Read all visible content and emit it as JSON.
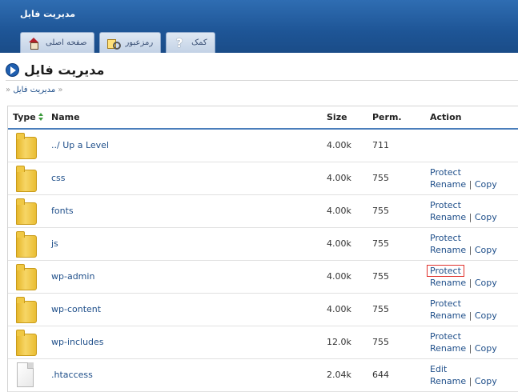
{
  "header": {
    "app_title": "مدیریت فایل"
  },
  "tabs": [
    {
      "label": "صفحه اصلی",
      "icon": "home-icon"
    },
    {
      "label": "رمزعبور",
      "icon": "key-icon"
    },
    {
      "label": "کمک",
      "icon": "help-icon",
      "glyph": "?"
    }
  ],
  "page": {
    "title": "مدیریت فایل",
    "breadcrumb_sep": "«",
    "breadcrumb_item": "مدیریت فایل",
    "breadcrumb_trail": "«"
  },
  "table": {
    "columns": {
      "type": "Type",
      "name": "Name",
      "size": "Size",
      "perm": "Perm.",
      "action": "Action"
    },
    "rows": [
      {
        "kind": "folder",
        "name": "../ Up a Level",
        "size": "4.00k",
        "perm": "711",
        "actions": []
      },
      {
        "kind": "folder",
        "name": "css",
        "size": "4.00k",
        "perm": "755",
        "actions": [
          "Protect",
          "Rename",
          "Copy"
        ]
      },
      {
        "kind": "folder",
        "name": "fonts",
        "size": "4.00k",
        "perm": "755",
        "actions": [
          "Protect",
          "Rename",
          "Copy"
        ]
      },
      {
        "kind": "folder",
        "name": "js",
        "size": "4.00k",
        "perm": "755",
        "actions": [
          "Protect",
          "Rename",
          "Copy"
        ]
      },
      {
        "kind": "folder",
        "name": "wp-admin",
        "size": "4.00k",
        "perm": "755",
        "actions": [
          "Protect",
          "Rename",
          "Copy"
        ],
        "highlight_first_action": true
      },
      {
        "kind": "folder",
        "name": "wp-content",
        "size": "4.00k",
        "perm": "755",
        "actions": [
          "Protect",
          "Rename",
          "Copy"
        ]
      },
      {
        "kind": "folder",
        "name": "wp-includes",
        "size": "12.0k",
        "perm": "755",
        "actions": [
          "Protect",
          "Rename",
          "Copy"
        ]
      },
      {
        "kind": "file",
        "name": ".htaccess",
        "size": "2.04k",
        "perm": "644",
        "actions": [
          "Edit",
          "Rename",
          "Copy"
        ]
      }
    ],
    "action_separator": "|"
  },
  "colors": {
    "header_blue": "#1e5596",
    "link": "#1f4f8a",
    "highlight_border": "#e0322d",
    "sort_arrow": "#3d9a3d"
  }
}
